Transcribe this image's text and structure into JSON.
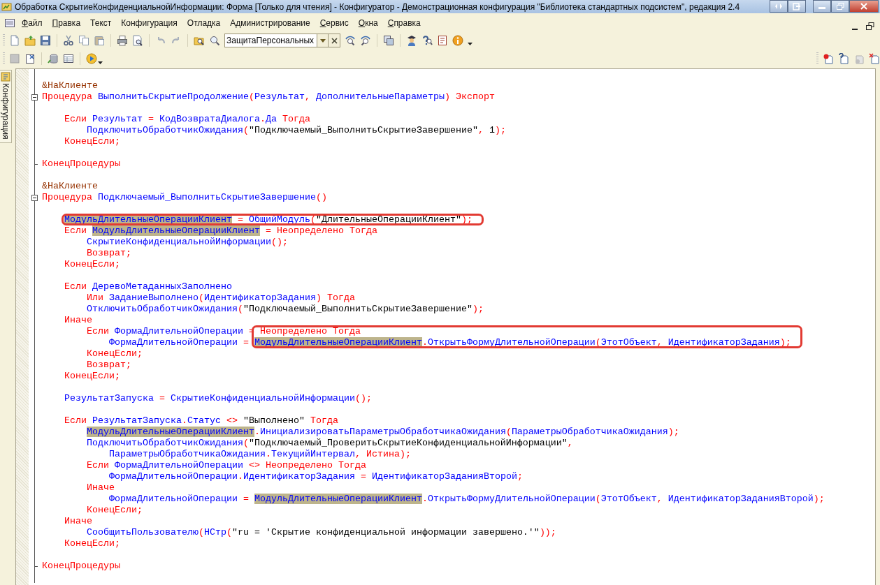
{
  "window": {
    "title": "Обработка СкрытиеКонфиденциальнойИнформации: Форма [Только для чтения] - Конфигуратор - Демонстрационная конфигурация \"Библиотека стандартных подсистем\", редакция 2.4"
  },
  "menu": [
    {
      "label": "Файл",
      "accelerator": true
    },
    {
      "label": "Правка",
      "accelerator": true
    },
    {
      "label": "Текст",
      "accelerator": false
    },
    {
      "label": "Конфигурация",
      "accelerator": false
    },
    {
      "label": "Отладка",
      "accelerator": false
    },
    {
      "label": "Администрирование",
      "accelerator": false
    },
    {
      "label": "Сервис",
      "accelerator": true
    },
    {
      "label": "Окна",
      "accelerator": true
    },
    {
      "label": "Справка",
      "accelerator": true
    }
  ],
  "toolbar": {
    "search": {
      "value": "ЗащитаПерсональных"
    }
  },
  "side_panel": {
    "tab": "Конфигурация"
  },
  "editor": {
    "lines": [
      {
        "kind": "blank"
      },
      {
        "kind": "code",
        "tokens": [
          {
            "text": "&НаКлиенте",
            "kind": "pre"
          }
        ]
      },
      {
        "kind": "fold_start",
        "tokens": [
          {
            "text": "Процедура ",
            "kind": "kw"
          },
          {
            "text": "ВыполнитьСкрытиеПродолжение",
            "kind": "id"
          },
          {
            "text": "(",
            "kind": "op"
          },
          {
            "text": "Результат",
            "kind": "id"
          },
          {
            "text": ", ",
            "kind": "op"
          },
          {
            "text": "ДополнительныеПараметры",
            "kind": "id"
          },
          {
            "text": ") ",
            "kind": "op"
          },
          {
            "text": "Экспорт",
            "kind": "kw"
          }
        ]
      },
      {
        "kind": "blank"
      },
      {
        "kind": "code",
        "tokens": [
          {
            "text": "    Если ",
            "kind": "kw"
          },
          {
            "text": "Результат",
            "kind": "id"
          },
          {
            "text": " = ",
            "kind": "op"
          },
          {
            "text": "КодВозвратаДиалога",
            "kind": "id"
          },
          {
            "text": ".",
            "kind": "op"
          },
          {
            "text": "Да",
            "kind": "id"
          },
          {
            "text": " Тогда",
            "kind": "kw"
          }
        ]
      },
      {
        "kind": "code",
        "tokens": [
          {
            "text": "        ПодключитьОбработчикОжидания",
            "kind": "id"
          },
          {
            "text": "(",
            "kind": "op"
          },
          {
            "text": "\"Подключаемый_ВыполнитьСкрытиеЗавершение\"",
            "kind": "str"
          },
          {
            "text": ", ",
            "kind": "op"
          },
          {
            "text": "1",
            "kind": "num"
          },
          {
            "text": ");",
            "kind": "op"
          }
        ]
      },
      {
        "kind": "code",
        "tokens": [
          {
            "text": "    КонецЕсли;",
            "kind": "kw"
          }
        ]
      },
      {
        "kind": "blank"
      },
      {
        "kind": "fold_end",
        "tokens": [
          {
            "text": "КонецПроцедуры",
            "kind": "kw"
          }
        ]
      },
      {
        "kind": "blank"
      },
      {
        "kind": "code",
        "tokens": [
          {
            "text": "&НаКлиенте",
            "kind": "pre"
          }
        ]
      },
      {
        "kind": "fold_start",
        "tokens": [
          {
            "text": "Процедура ",
            "kind": "kw"
          },
          {
            "text": "Подключаемый_ВыполнитьСкрытиеЗавершение",
            "kind": "id"
          },
          {
            "text": "()",
            "kind": "op"
          }
        ]
      },
      {
        "kind": "blank"
      },
      {
        "kind": "code",
        "callout_tokens": [
          {
            "text": "    МодульДлительныеОперацииКлиент",
            "kind": "hl"
          },
          {
            "text": " = ",
            "kind": "op"
          },
          {
            "text": "ОбщийМодуль",
            "kind": "id"
          },
          {
            "text": "(",
            "kind": "op"
          },
          {
            "text": "\"ДлительныеОперацииКлиент\"",
            "kind": "str"
          },
          {
            "text": ");",
            "kind": "op"
          }
        ]
      },
      {
        "kind": "code",
        "tokens": [
          {
            "text": "    Если ",
            "kind": "kw"
          },
          {
            "text": "МодульДлительныеОперацииКлиент",
            "kind": "hl"
          },
          {
            "text": " = ",
            "kind": "op"
          },
          {
            "text": "Неопределено Тогда",
            "kind": "kw"
          }
        ]
      },
      {
        "kind": "code",
        "tokens": [
          {
            "text": "        СкрытиеКонфиденциальнойИнформации",
            "kind": "id"
          },
          {
            "text": "();",
            "kind": "op"
          }
        ]
      },
      {
        "kind": "code",
        "tokens": [
          {
            "text": "        Возврат;",
            "kind": "kw"
          }
        ]
      },
      {
        "kind": "code",
        "tokens": [
          {
            "text": "    КонецЕсли;",
            "kind": "kw"
          }
        ]
      },
      {
        "kind": "blank"
      },
      {
        "kind": "code",
        "tokens": [
          {
            "text": "    Если ",
            "kind": "kw"
          },
          {
            "text": "ДеревоМетаданныхЗаполнено",
            "kind": "id"
          }
        ]
      },
      {
        "kind": "code",
        "tokens": [
          {
            "text": "        Или ",
            "kind": "kw"
          },
          {
            "text": "ЗаданиеВыполнено",
            "kind": "id"
          },
          {
            "text": "(",
            "kind": "op"
          },
          {
            "text": "ИдентификаторЗадания",
            "kind": "id"
          },
          {
            "text": ") ",
            "kind": "op"
          },
          {
            "text": "Тогда",
            "kind": "kw"
          }
        ]
      },
      {
        "kind": "code",
        "tokens": [
          {
            "text": "        ОтключитьОбработчикОжидания",
            "kind": "id"
          },
          {
            "text": "(",
            "kind": "op"
          },
          {
            "text": "\"Подключаемый_ВыполнитьСкрытиеЗавершение\"",
            "kind": "str"
          },
          {
            "text": ");",
            "kind": "op"
          }
        ]
      },
      {
        "kind": "code",
        "tokens": [
          {
            "text": "    Иначе",
            "kind": "kw"
          }
        ]
      },
      {
        "kind": "code",
        "tokens": [
          {
            "text": "        Если ",
            "kind": "kw"
          },
          {
            "text": "ФормаДлительнойОперации",
            "kind": "id"
          },
          {
            "text": " = ",
            "kind": "op"
          }
        ],
        "callout_tokens": [
          {
            "text": "Неопределено",
            "kind": "kw"
          },
          {
            "text": " Тогда",
            "kind": "kw"
          }
        ]
      },
      {
        "kind": "code",
        "tokens": [
          {
            "text": "            ФормаДлительнойОперации",
            "kind": "id"
          },
          {
            "text": " = ",
            "kind": "op"
          }
        ],
        "callout_tokens": [
          {
            "text": "МодульДлительныеОперацииКлиент",
            "kind": "hl"
          },
          {
            "text": ".",
            "kind": "op"
          },
          {
            "text": "ОткрытьФормуДлительнойОперации",
            "kind": "id"
          },
          {
            "text": "(",
            "kind": "op"
          },
          {
            "text": "ЭтотОбъект",
            "kind": "id"
          },
          {
            "text": ", ",
            "kind": "op"
          },
          {
            "text": "ИдентификаторЗадания",
            "kind": "id"
          },
          {
            "text": ");",
            "kind": "op"
          }
        ]
      },
      {
        "kind": "code",
        "tokens": [
          {
            "text": "        КонецЕсли;",
            "kind": "kw"
          }
        ]
      },
      {
        "kind": "code",
        "tokens": [
          {
            "text": "        Возврат;",
            "kind": "kw"
          }
        ]
      },
      {
        "kind": "code",
        "tokens": [
          {
            "text": "    КонецЕсли;",
            "kind": "kw"
          }
        ]
      },
      {
        "kind": "blank"
      },
      {
        "kind": "code",
        "tokens": [
          {
            "text": "    РезультатЗапуска",
            "kind": "id"
          },
          {
            "text": " = ",
            "kind": "op"
          },
          {
            "text": "СкрытиеКонфиденциальнойИнформации",
            "kind": "id"
          },
          {
            "text": "();",
            "kind": "op"
          }
        ]
      },
      {
        "kind": "blank"
      },
      {
        "kind": "code",
        "tokens": [
          {
            "text": "    Если ",
            "kind": "kw"
          },
          {
            "text": "РезультатЗапуска",
            "kind": "id"
          },
          {
            "text": ".",
            "kind": "op"
          },
          {
            "text": "Статус",
            "kind": "id"
          },
          {
            "text": " <> ",
            "kind": "op"
          },
          {
            "text": "\"Выполнено\"",
            "kind": "str"
          },
          {
            "text": " Тогда",
            "kind": "kw"
          }
        ]
      },
      {
        "kind": "code",
        "tokens": [
          {
            "text": "        МодульДлительныеОперацииКлиент",
            "kind": "hl"
          },
          {
            "text": ".",
            "kind": "op"
          },
          {
            "text": "ИнициализироватьПараметрыОбработчикаОжидания",
            "kind": "id"
          },
          {
            "text": "(",
            "kind": "op"
          },
          {
            "text": "ПараметрыОбработчикаОжидания",
            "kind": "id"
          },
          {
            "text": ");",
            "kind": "op"
          }
        ]
      },
      {
        "kind": "code",
        "tokens": [
          {
            "text": "        ПодключитьОбработчикОжидания",
            "kind": "id"
          },
          {
            "text": "(",
            "kind": "op"
          },
          {
            "text": "\"Подключаемый_ПроверитьСкрытиеКонфиденциальнойИнформации\"",
            "kind": "str"
          },
          {
            "text": ",",
            "kind": "op"
          }
        ]
      },
      {
        "kind": "code",
        "tokens": [
          {
            "text": "            ПараметрыОбработчикаОжидания",
            "kind": "id"
          },
          {
            "text": ".",
            "kind": "op"
          },
          {
            "text": "ТекущийИнтервал",
            "kind": "id"
          },
          {
            "text": ", ",
            "kind": "op"
          },
          {
            "text": "Истина",
            "kind": "kw"
          },
          {
            "text": ");",
            "kind": "op"
          }
        ]
      },
      {
        "kind": "code",
        "tokens": [
          {
            "text": "        Если ",
            "kind": "kw"
          },
          {
            "text": "ФормаДлительнойОперации",
            "kind": "id"
          },
          {
            "text": " <> ",
            "kind": "op"
          },
          {
            "text": "Неопределено Тогда",
            "kind": "kw"
          }
        ]
      },
      {
        "kind": "code",
        "tokens": [
          {
            "text": "            ФормаДлительнойОперации",
            "kind": "id"
          },
          {
            "text": ".",
            "kind": "op"
          },
          {
            "text": "ИдентификаторЗадания",
            "kind": "id"
          },
          {
            "text": " = ",
            "kind": "op"
          },
          {
            "text": "ИдентификаторЗаданияВторой",
            "kind": "id"
          },
          {
            "text": ";",
            "kind": "op"
          }
        ]
      },
      {
        "kind": "code",
        "tokens": [
          {
            "text": "        Иначе",
            "kind": "kw"
          }
        ]
      },
      {
        "kind": "code",
        "tokens": [
          {
            "text": "            ФормаДлительнойОперации",
            "kind": "id"
          },
          {
            "text": " = ",
            "kind": "op"
          },
          {
            "text": "МодульДлительныеОперацииКлиент",
            "kind": "hl"
          },
          {
            "text": ".",
            "kind": "op"
          },
          {
            "text": "ОткрытьФормуДлительнойОперации",
            "kind": "id"
          },
          {
            "text": "(",
            "kind": "op"
          },
          {
            "text": "ЭтотОбъект",
            "kind": "id"
          },
          {
            "text": ", ",
            "kind": "op"
          },
          {
            "text": "ИдентификаторЗаданияВторой",
            "kind": "id"
          },
          {
            "text": ");",
            "kind": "op"
          }
        ]
      },
      {
        "kind": "code",
        "tokens": [
          {
            "text": "        КонецЕсли;",
            "kind": "kw"
          }
        ]
      },
      {
        "kind": "code",
        "tokens": [
          {
            "text": "    Иначе",
            "kind": "kw"
          }
        ]
      },
      {
        "kind": "code",
        "tokens": [
          {
            "text": "        СообщитьПользователю",
            "kind": "id"
          },
          {
            "text": "(",
            "kind": "op"
          },
          {
            "text": "НСтр",
            "kind": "id"
          },
          {
            "text": "(",
            "kind": "op"
          },
          {
            "text": "\"ru = 'Скрытие конфиденциальной информации завершено.'\"",
            "kind": "str"
          },
          {
            "text": "));",
            "kind": "op"
          }
        ]
      },
      {
        "kind": "code",
        "tokens": [
          {
            "text": "    КонецЕсли;",
            "kind": "kw"
          }
        ]
      },
      {
        "kind": "blank"
      },
      {
        "kind": "fold_end",
        "tokens": [
          {
            "text": "КонецПроцедуры",
            "kind": "kw"
          }
        ]
      },
      {
        "kind": "blank"
      }
    ]
  }
}
